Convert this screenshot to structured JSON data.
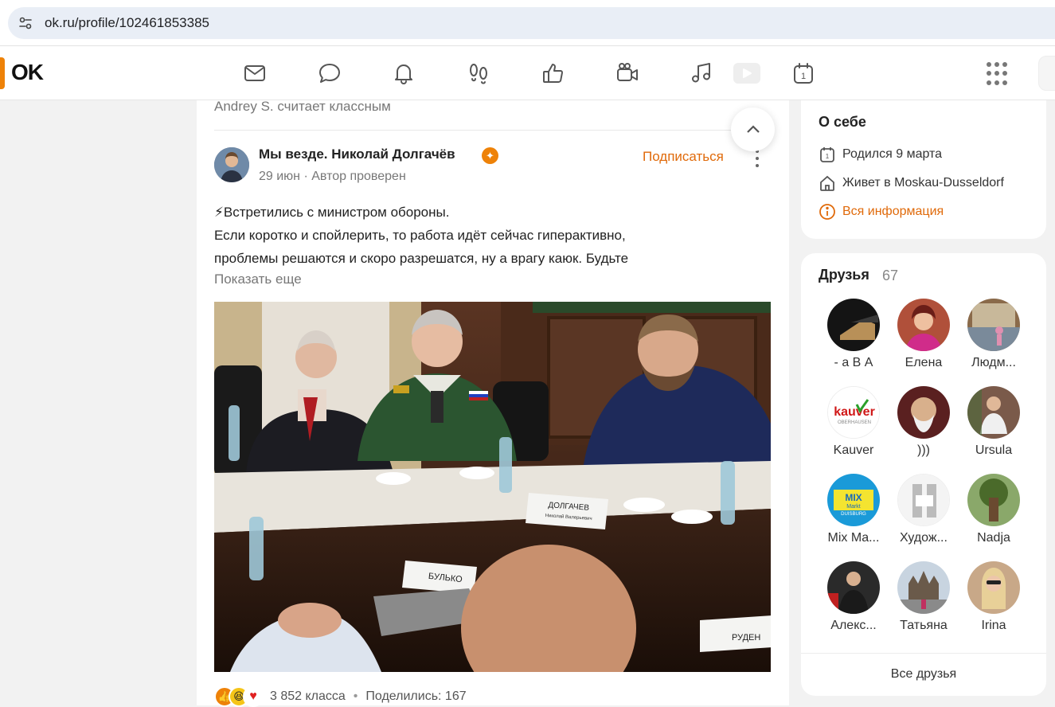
{
  "browser": {
    "url": "ok.ru/profile/102461853385"
  },
  "header": {
    "logo_text": "OK",
    "nav_icons": [
      "mail-icon",
      "chat-icon",
      "bell-icon",
      "footprints-icon",
      "like-icon",
      "video-camera-icon",
      "music-icon",
      "play-icon",
      "calendar-icon",
      "apps-grid-icon"
    ],
    "calendar_day": "1"
  },
  "feed": {
    "liked_by": "Andrey S. считает классным",
    "post": {
      "author": "Мы везде. Николай Долгачёв",
      "date": "29 июн",
      "verified_label": "Автор проверен",
      "subscribe_label": "Подписаться",
      "text_lines": [
        "⚡Встретились с министром обороны.",
        "Если коротко и спойлерить, то работа идёт сейчас гиперактивно,",
        "проблемы решаются и скоро разрешатся, ну а врагу каюк. Будьте"
      ],
      "show_more": "Показать еще",
      "photo_name_plate": "ДОЛГАЧЕВ",
      "photo_name_plate_sub": "Николай Валерьевич",
      "photo_plate_2": "БУЛЬКО",
      "photo_plate_3": "РУДЕН",
      "reactions_count": "3 852 класса",
      "shares": "Поделились: 167"
    }
  },
  "about": {
    "title": "О себе",
    "born": "Родился 9 марта",
    "lives": "Живет в Moskau-Dusseldorf",
    "all_info": "Вся информация",
    "calendar_day": "1"
  },
  "friends": {
    "title": "Друзья",
    "count": "67",
    "items": [
      {
        "name": "- а В А",
        "color": "#1c1c1c"
      },
      {
        "name": "Елена",
        "color": "#b0503a"
      },
      {
        "name": "Людм...",
        "color": "#8a6a4a"
      },
      {
        "name": "Kauver",
        "color": "#ffffff"
      },
      {
        "name": ")))",
        "color": "#5a2020"
      },
      {
        "name": "Ursula",
        "color": "#7a5a4a"
      },
      {
        "name": "Mix Ma...",
        "color": "#1a9ad8"
      },
      {
        "name": "Худож...",
        "color": "#f0f0f0"
      },
      {
        "name": "Nadja",
        "color": "#5a7a3a"
      },
      {
        "name": "Алекс...",
        "color": "#2a2a2a"
      },
      {
        "name": "Татьяна",
        "color": "#a0a8b0"
      },
      {
        "name": "Irina",
        "color": "#c8a888"
      }
    ],
    "all_label": "Все друзья",
    "kauver_logo_text": "kauver",
    "kauver_logo_sub": "OBERHAUSEN",
    "mix_logo_text": "MIX",
    "mix_logo_sub": "Markt",
    "mix_logo_city": "DUISBURG"
  }
}
